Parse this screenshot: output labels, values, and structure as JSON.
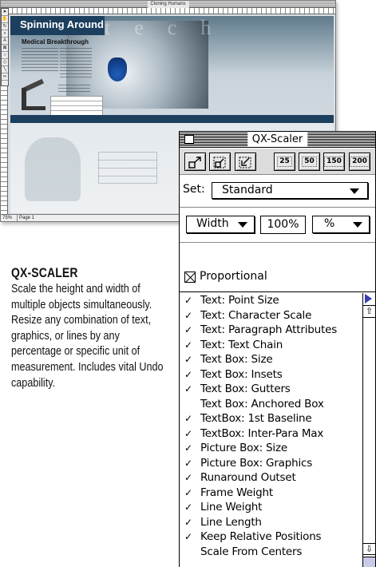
{
  "document_window": {
    "title": "Cloning Humans",
    "headline": "Spinning Around",
    "subhead": "Medical Breakthrough",
    "background_word": "tech",
    "zoom": "75%",
    "page_label": "Page 1"
  },
  "description": {
    "title": "QX-SCALER",
    "body": "Scale the height and width of multiple objects simultaneously. Resize any combination of text, graphics, or lines by any percentage or specific unit of measurement. Includes vital Undo capability."
  },
  "palette": {
    "title": "QX-Scaler",
    "toolbar": {
      "preset_25": "25",
      "preset_50": "50",
      "preset_150": "150",
      "preset_200": "200"
    },
    "set_label": "Set:",
    "set_value": "Standard",
    "dimension_value": "Width",
    "percent_value": "100%",
    "unit_value": "%",
    "proportional_label": "Proportional",
    "proportional_checked": true,
    "options": [
      {
        "label": "Text: Point Size",
        "checked": true
      },
      {
        "label": "Text: Character Scale",
        "checked": true
      },
      {
        "label": "Text: Paragraph Attributes",
        "checked": true
      },
      {
        "label": "Text: Text Chain",
        "checked": true
      },
      {
        "label": "Text Box: Size",
        "checked": true
      },
      {
        "label": "Text Box: Insets",
        "checked": true
      },
      {
        "label": "Text Box: Gutters",
        "checked": true
      },
      {
        "label": "Text Box: Anchored Box",
        "checked": false
      },
      {
        "label": "TextBox: 1st Baseline",
        "checked": true
      },
      {
        "label": "TextBox: Inter-Para Max",
        "checked": true
      },
      {
        "label": "Picture Box: Size",
        "checked": true
      },
      {
        "label": "Picture Box: Graphics",
        "checked": true
      },
      {
        "label": "Runaround Outset",
        "checked": true
      },
      {
        "label": "Frame Weight",
        "checked": true
      },
      {
        "label": "Line Weight",
        "checked": true
      },
      {
        "label": "Line Length",
        "checked": true
      },
      {
        "label": "Keep Relative Positions",
        "checked": true
      },
      {
        "label": "Scale From Centers",
        "checked": false
      }
    ],
    "check_glyph": "✓"
  },
  "colors": {
    "doc_navy": "#1d3f5e",
    "scroll_accent": "#3a40b0"
  }
}
